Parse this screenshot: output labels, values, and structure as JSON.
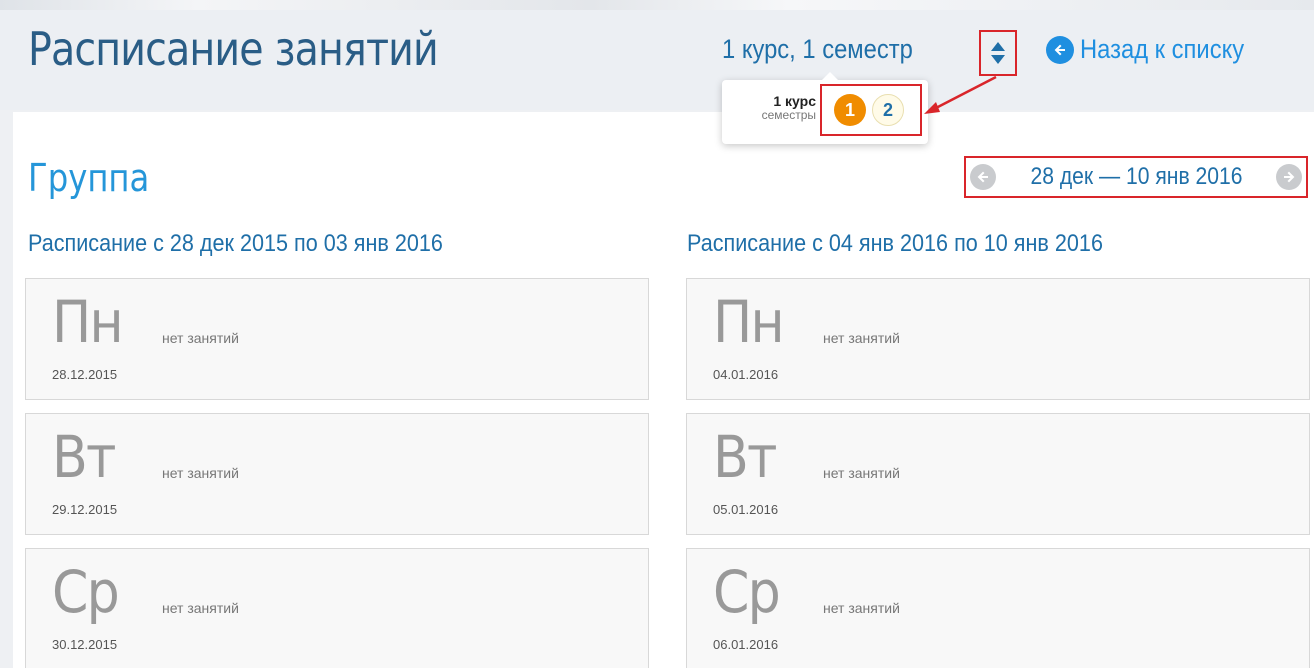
{
  "header": {
    "title": "Расписание занятий",
    "course_select_label": "1 курс, 1 семестр",
    "back_label": "Назад к списку"
  },
  "popover": {
    "course": "1 курс",
    "semesters_label": "семестры",
    "semesters": [
      "1",
      "2"
    ],
    "active_semester": "1"
  },
  "group": {
    "title": "Группа",
    "week_range": "28 дек — 10 янв 2016"
  },
  "columns": [
    {
      "title": "Расписание с 28 дек 2015 по 03 янв 2016",
      "days": [
        {
          "name": "Пн",
          "status": "нет занятий",
          "date": "28.12.2015"
        },
        {
          "name": "Вт",
          "status": "нет занятий",
          "date": "29.12.2015"
        },
        {
          "name": "Ср",
          "status": "нет занятий",
          "date": "30.12.2015"
        }
      ]
    },
    {
      "title": "Расписание с 04 янв 2016 по 10 янв 2016",
      "days": [
        {
          "name": "Пн",
          "status": "нет занятий",
          "date": "04.01.2016"
        },
        {
          "name": "Вт",
          "status": "нет занятий",
          "date": "05.01.2016"
        },
        {
          "name": "Ср",
          "status": "нет занятий",
          "date": "06.01.2016"
        }
      ]
    }
  ],
  "colors": {
    "title_blue": "#2a5d86",
    "link_blue": "#1f8fe0",
    "accent_orange": "#f08c00",
    "highlight_red": "#d9252a"
  }
}
